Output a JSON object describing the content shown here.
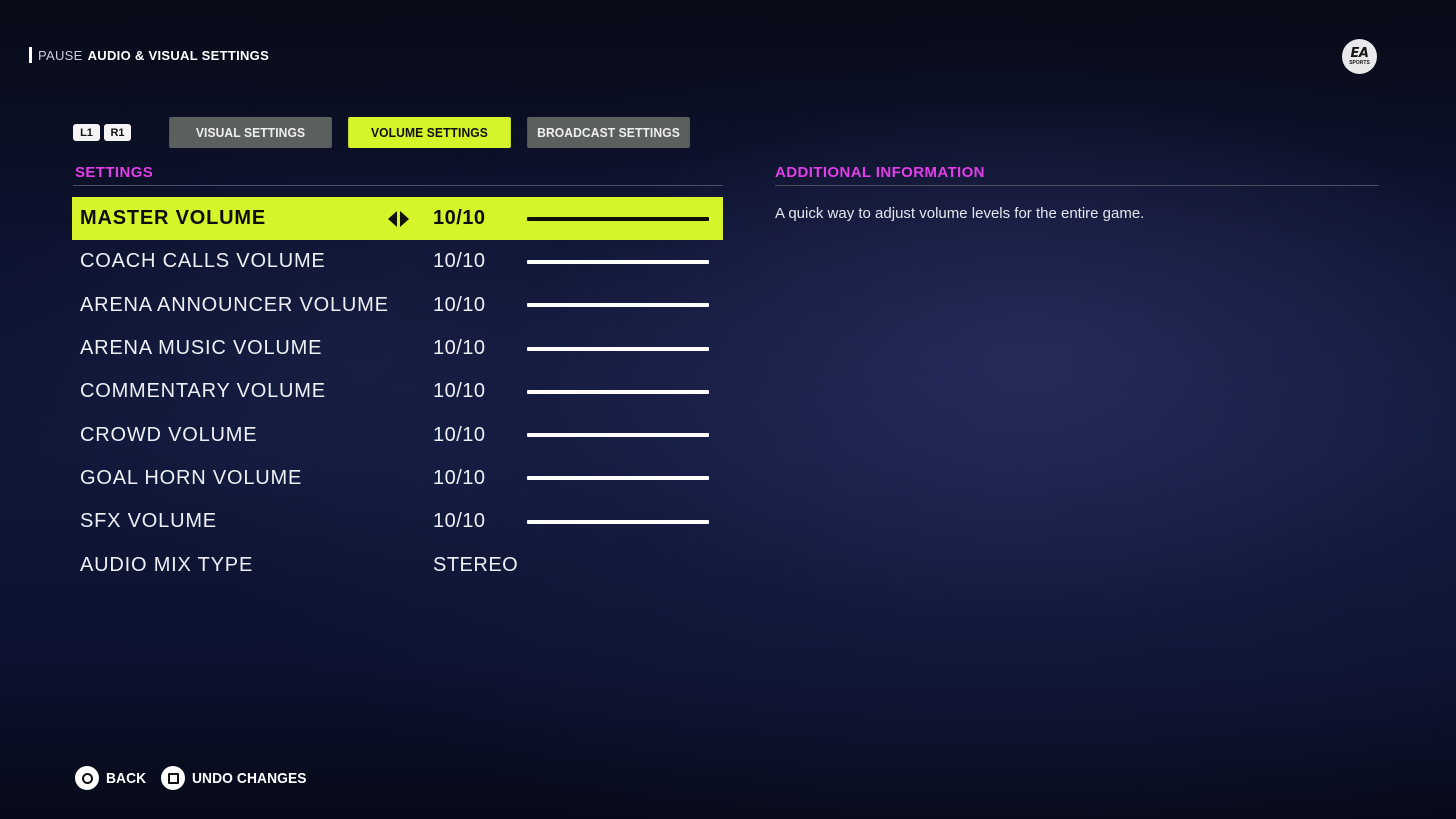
{
  "header": {
    "breadcrumb_parent": "PAUSE",
    "breadcrumb_current": "AUDIO & VISUAL SETTINGS",
    "logo": {
      "line1": "EA",
      "line2": "SPORTS"
    }
  },
  "bumpers": {
    "left": "L1",
    "right": "R1"
  },
  "tabs": [
    {
      "label": "VISUAL SETTINGS",
      "active": false
    },
    {
      "label": "VOLUME SETTINGS",
      "active": true
    },
    {
      "label": "BROADCAST SETTINGS",
      "active": false
    }
  ],
  "settings": {
    "header": "SETTINGS",
    "rows": [
      {
        "label": "MASTER VOLUME",
        "value": "10/10",
        "level": 1.0,
        "selected": true
      },
      {
        "label": "COACH CALLS VOLUME",
        "value": "10/10",
        "level": 1.0,
        "selected": false
      },
      {
        "label": "ARENA ANNOUNCER VOLUME",
        "value": "10/10",
        "level": 1.0,
        "selected": false
      },
      {
        "label": "ARENA MUSIC VOLUME",
        "value": "10/10",
        "level": 1.0,
        "selected": false
      },
      {
        "label": "COMMENTARY VOLUME",
        "value": "10/10",
        "level": 1.0,
        "selected": false
      },
      {
        "label": "CROWD VOLUME",
        "value": "10/10",
        "level": 1.0,
        "selected": false
      },
      {
        "label": "GOAL HORN VOLUME",
        "value": "10/10",
        "level": 1.0,
        "selected": false
      },
      {
        "label": "SFX VOLUME",
        "value": "10/10",
        "level": 1.0,
        "selected": false
      },
      {
        "label": "AUDIO MIX TYPE",
        "value": "STEREO",
        "selected": false
      }
    ]
  },
  "info": {
    "header": "ADDITIONAL INFORMATION",
    "text": "A quick way to adjust volume levels for the entire game."
  },
  "footer": {
    "back_label": "BACK",
    "back_icon": "circle-button-icon",
    "undo_label": "UNDO CHANGES",
    "undo_icon": "square-button-icon"
  },
  "colors": {
    "accent": "#d5f52a",
    "section_header": "#e13ee8",
    "tab_inactive": "#5b605f",
    "background": "#0d1330"
  }
}
